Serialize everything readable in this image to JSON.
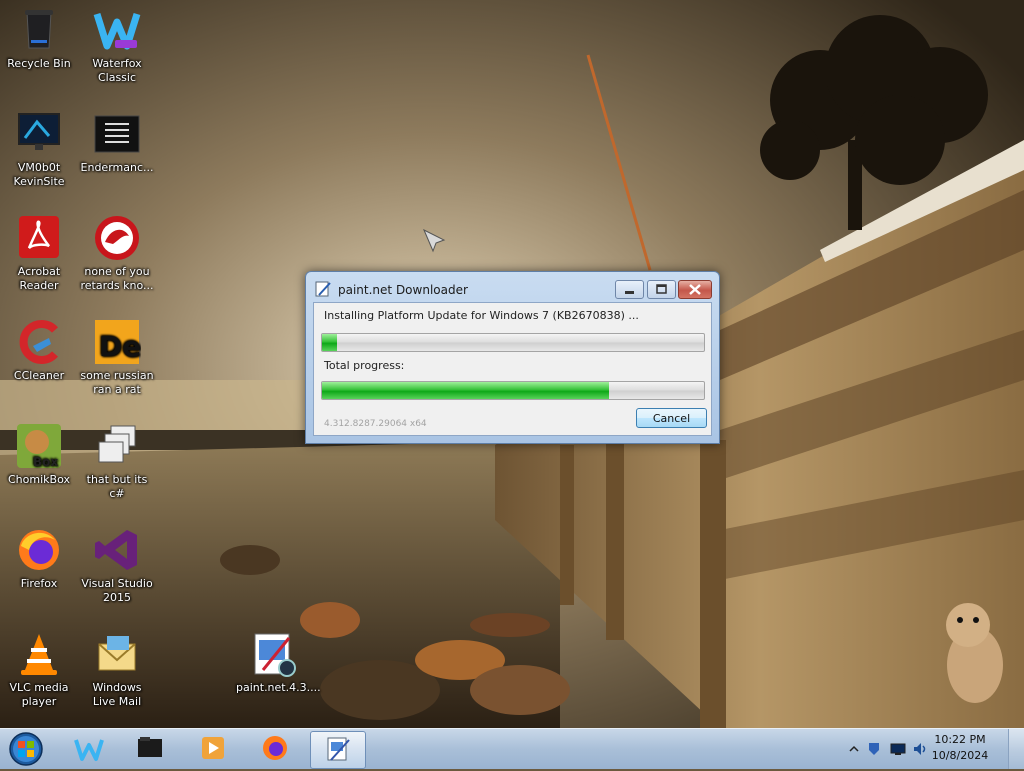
{
  "desktop": {
    "icons": [
      {
        "label": "Recycle Bin"
      },
      {
        "label": "Waterfox Classic"
      },
      {
        "label": "VM0b0t KevinSite"
      },
      {
        "label": "Endermanc..."
      },
      {
        "label": "Acrobat Reader"
      },
      {
        "label": "none of you retards kno..."
      },
      {
        "label": "CCleaner"
      },
      {
        "label": "some russian ran a rat"
      },
      {
        "label": "ChomikBox"
      },
      {
        "label": "that but its c#"
      },
      {
        "label": "Firefox"
      },
      {
        "label": "Visual Studio 2015"
      },
      {
        "label": "VLC media player"
      },
      {
        "label": "Windows Live Mail"
      },
      {
        "label": "paint.net.4.3...."
      }
    ]
  },
  "dialog": {
    "title": "paint.net Downloader",
    "status": "Installing Platform Update for Windows 7 (KB2670838) ...",
    "current_progress": 0.04,
    "total_label": "Total progress:",
    "total_progress": 0.75,
    "cancel_label": "Cancel",
    "version": "4.312.8287.29064 x64"
  },
  "taskbar": {
    "items": [
      "Start",
      "Waterfox Classic",
      "Endermanch folder",
      "Windows Media Player",
      "Firefox",
      "paint.net Downloader"
    ],
    "clock_time": "10:22 PM",
    "clock_date": "10/8/2024"
  },
  "colors": {
    "progress_green": "#12a81c",
    "titlebar": "#b9d1ea",
    "taskbar": "#a9bfd8"
  }
}
